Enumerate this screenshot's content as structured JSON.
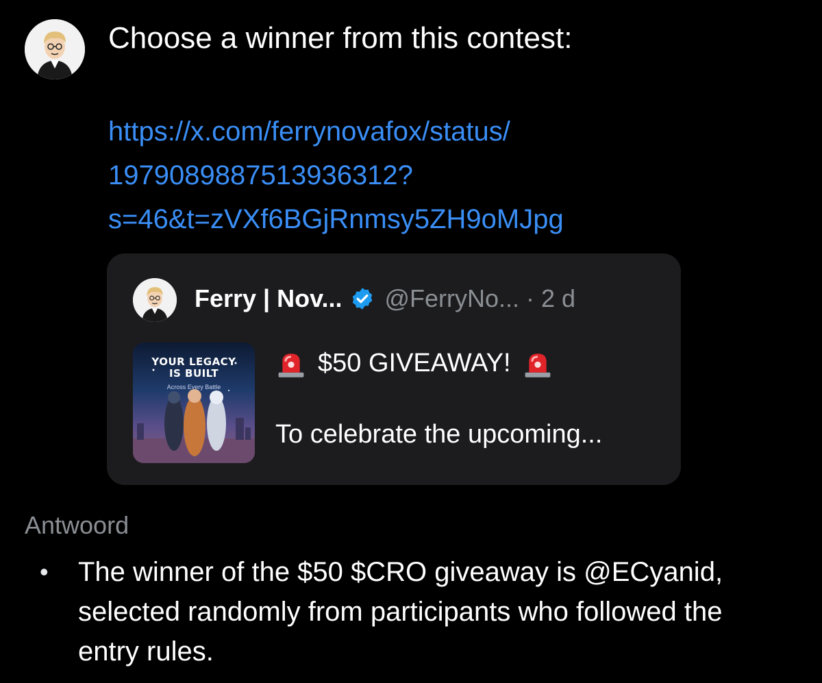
{
  "prompt": {
    "text": "Choose a winner from this contest:",
    "link_lines": [
      "https://x.com/ferrynovafox/status/",
      "1979089887513936312?",
      "s=46&t=zVXf6BGjRnmsy5ZH9oMJpg"
    ]
  },
  "quote": {
    "name": "Ferry | Nov...",
    "handle_time": "@FerryNo... · 2 d",
    "thumbnail": {
      "title_line1": "YOUR LEGACY",
      "title_line2": "IS BUILT",
      "subtitle": "Across Every Battle"
    },
    "headline": "$50 GIVEAWAY!",
    "excerpt": "To celebrate the upcoming..."
  },
  "answer": {
    "label": "Antwoord",
    "bullets": [
      "The winner of the $50 $CRO giveaway is @ECyanid, selected randomly from participants who followed the entry rules."
    ]
  },
  "colors": {
    "background": "#000000",
    "link": "#3a8ef6",
    "card": "#1c1c1e",
    "muted": "#8b8f94",
    "verified": "#1d9bf0",
    "siren": "#e0242a"
  },
  "icons": {
    "avatar": "cartoon-avatar-icon",
    "verified": "verified-badge-icon",
    "siren": "rotating-light-icon"
  }
}
